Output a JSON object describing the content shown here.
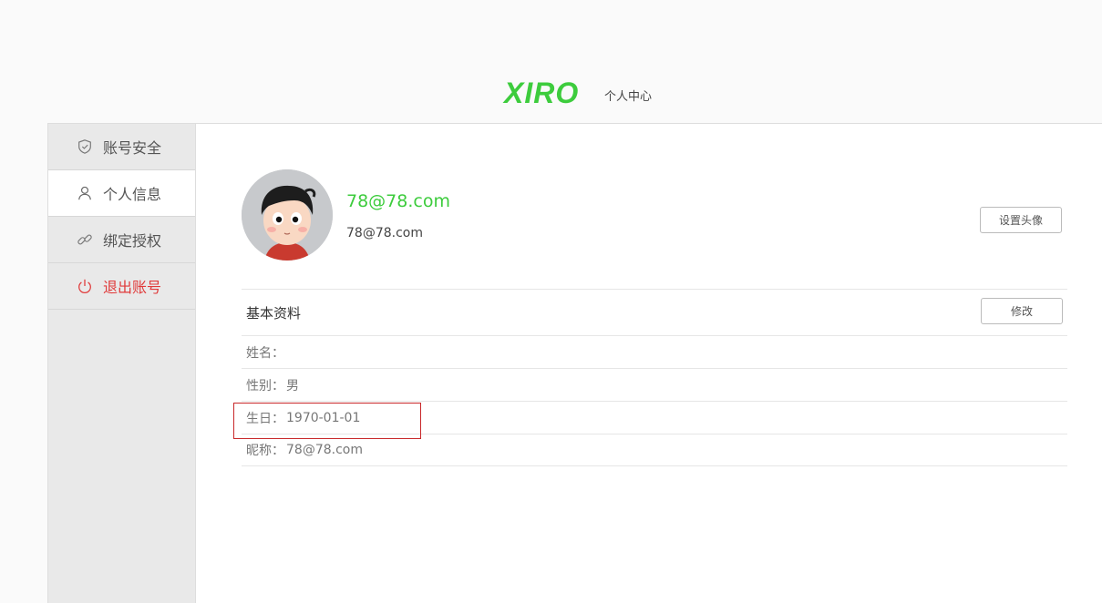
{
  "header": {
    "logo": "XIRO",
    "subtitle": "个人中心",
    "logo_color": "#3dcc3d"
  },
  "sidebar": {
    "items": [
      {
        "label": "账号安全",
        "icon": "shield-icon"
      },
      {
        "label": "个人信息",
        "icon": "user-icon",
        "active": true
      },
      {
        "label": "绑定授权",
        "icon": "link-icon"
      },
      {
        "label": "退出账号",
        "icon": "power-icon",
        "color": "#e03a3a"
      }
    ]
  },
  "profile": {
    "display_name": "78@78.com",
    "email": "78@78.com",
    "name_color": "#3dcc3d",
    "set_avatar_label": "设置头像"
  },
  "basic_info": {
    "title": "基本资料",
    "edit_label": "修改",
    "fields": [
      {
        "key": "姓名：",
        "value": ""
      },
      {
        "key": "性别：",
        "value": "男"
      },
      {
        "key": "生日：",
        "value": "1970-01-01"
      },
      {
        "key": "昵称：",
        "value": "78@78.com"
      }
    ]
  }
}
